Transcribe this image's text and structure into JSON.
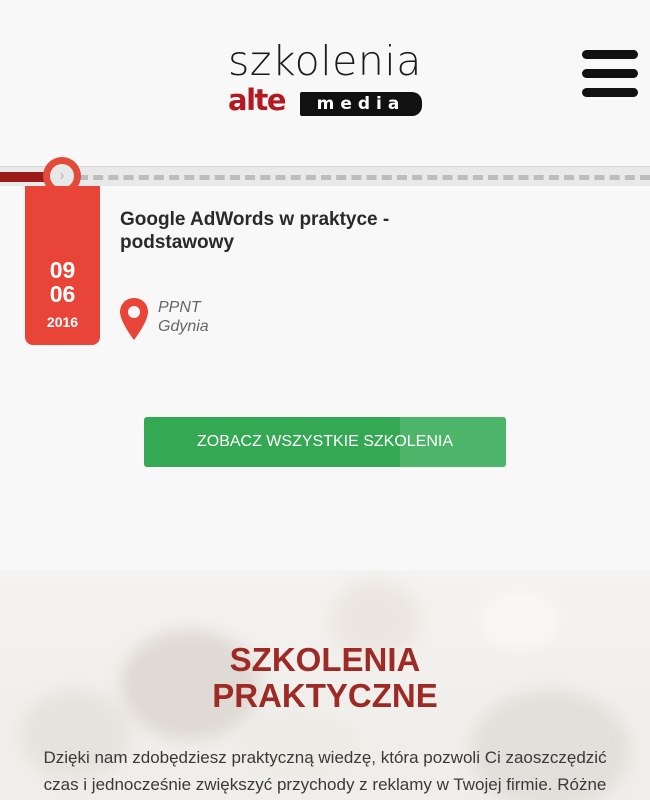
{
  "header": {
    "logo_top": "szkolenia",
    "logo_alte": "alte",
    "logo_media": "media",
    "menu_icon": "hamburger-icon"
  },
  "timeline": {
    "icon": "chevron-right-icon",
    "arrow": "›"
  },
  "event": {
    "day": "09",
    "month": "06",
    "year": "2016",
    "title": "Google AdWords w praktyce - podstawowy",
    "location_icon": "map-pin-icon",
    "location_place": "PPNT",
    "location_city": "Gdynia"
  },
  "cta": {
    "label": "ZOBACZ WSZYSTKIE SZKOLENIA"
  },
  "hero": {
    "title_line1": "SZKOLENIA",
    "title_line2": "PRAKTYCZNE",
    "text": "Dzięki nam zdobędziesz praktyczną wiedzę, która pozwoli Ci zaoszczędzić czas i jednocześnie zwiększyć przychody z reklamy w Twojej firmie. Różne"
  },
  "colors": {
    "accent_red": "#e84437",
    "brand_red": "#b3191e",
    "button_green": "#34a853",
    "title_red": "#9e2a25"
  }
}
